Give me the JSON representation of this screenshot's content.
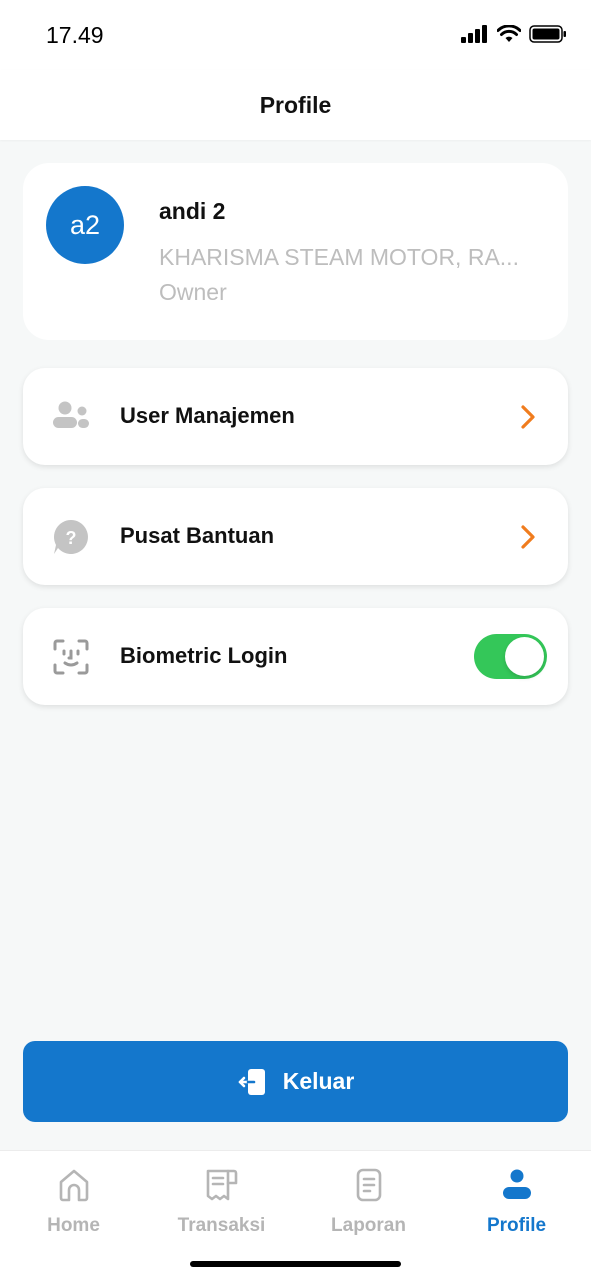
{
  "status": {
    "time": "17.49"
  },
  "header": {
    "title": "Profile"
  },
  "profile": {
    "initials": "a2",
    "name": "andi 2",
    "company": "KHARISMA STEAM MOTOR, RA...",
    "role": "Owner"
  },
  "menu": [
    {
      "label": "User Manajemen",
      "icon": "users-icon"
    },
    {
      "label": "Pusat Bantuan",
      "icon": "help-circle-icon"
    },
    {
      "label": "Biometric Login",
      "icon": "face-id-icon",
      "toggle_on": true
    }
  ],
  "logout": {
    "label": "Keluar"
  },
  "tabs": [
    {
      "label": "Home",
      "icon": "home-icon"
    },
    {
      "label": "Transaksi",
      "icon": "receipt-icon"
    },
    {
      "label": "Laporan",
      "icon": "document-icon"
    },
    {
      "label": "Profile",
      "icon": "person-icon",
      "active": true
    }
  ],
  "colors": {
    "primary": "#1477cc",
    "accent_chevron": "#f07c1e",
    "toggle_on": "#34c759",
    "muted_text": "#bdbdbd",
    "inactive_tab": "#b5b5b5"
  }
}
